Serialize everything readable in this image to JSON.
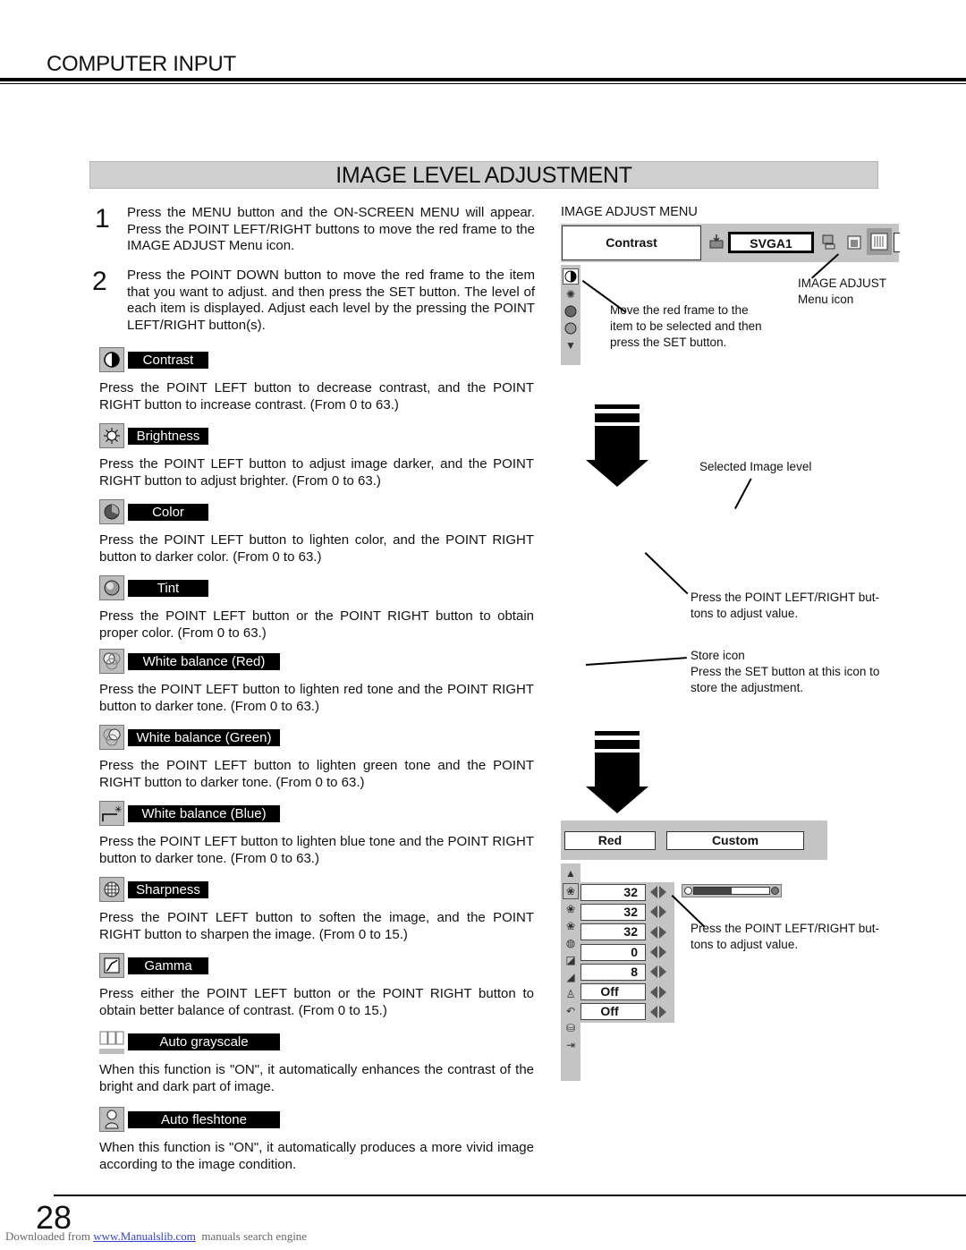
{
  "header": {
    "section_title": "COMPUTER INPUT",
    "banner_title": "IMAGE LEVEL ADJUSTMENT"
  },
  "steps": [
    {
      "num": "1",
      "text": "Press the MENU button and the ON-SCREEN MENU will appear.  Press the POINT LEFT/RIGHT buttons to move the red frame to the IMAGE ADJUST Menu icon."
    },
    {
      "num": "2",
      "text": "Press the POINT DOWN button to move the red frame to the item that you want to adjust. and then press the SET button.  The level of each item is displayed.  Adjust each level by the pressing the POINT LEFT/RIGHT button(s)."
    }
  ],
  "items": [
    {
      "icon": "contrast-icon",
      "label": "Contrast",
      "desc": "Press the POINT LEFT button to decrease contrast, and the POINT RIGHT button to increase contrast.  (From 0 to 63.)"
    },
    {
      "icon": "brightness-icon",
      "label": "Brightness",
      "desc": "Press the POINT LEFT button to adjust image darker, and the POINT RIGHT button to adjust brighter.  (From 0 to 63.)"
    },
    {
      "icon": "color-icon",
      "label": "Color",
      "desc": "Press the POINT LEFT button to lighten color, and the POINT RIGHT button to darker color.  (From 0 to 63.)"
    },
    {
      "icon": "tint-icon",
      "label": "Tint",
      "desc": "Press the POINT LEFT button or the POINT RIGHT button to obtain proper color.  (From 0 to 63.)"
    },
    {
      "icon": "white-balance-red-icon",
      "label": "White balance (Red)",
      "desc": "Press the POINT LEFT button to lighten red tone and the POINT RIGHT button to darker tone.  (From 0 to 63.)"
    },
    {
      "icon": "white-balance-green-icon",
      "label": "White balance (Green)",
      "desc": "Press the POINT LEFT button to lighten green tone and the POINT RIGHT button to darker tone.  (From 0 to 63.)"
    },
    {
      "icon": "white-balance-blue-icon",
      "label": "White balance (Blue)",
      "desc": "Press the POINT LEFT button to lighten blue tone and the POINT RIGHT button to darker tone.  (From 0 to 63.)"
    },
    {
      "icon": "sharpness-icon",
      "label": "Sharpness",
      "desc": "Press the POINT LEFT button to soften the image, and the POINT RIGHT button to sharpen the image.  (From 0 to 15.)"
    },
    {
      "icon": "gamma-icon",
      "label": "Gamma",
      "desc": "Press either the POINT LEFT button or the POINT RIGHT button to obtain better balance of contrast.  (From 0 to 15.)"
    },
    {
      "icon": "auto-grayscale-icon",
      "label": "Auto grayscale",
      "desc": "When this function is \"ON\", it automatically enhances the contrast of the bright and dark part of image."
    },
    {
      "icon": "auto-fleshtone-icon",
      "label": "Auto fleshtone",
      "desc": "When this function is \"ON\", it automatically produces a more vivid image according to the image condition."
    }
  ],
  "menu1": {
    "heading": "IMAGE ADJUST MENU",
    "selected_item": "Contrast",
    "source": "SVGA1",
    "callout_icon": "IMAGE ADJUST\nMenu icon",
    "callout_icon_l1": "IMAGE ADJUST",
    "callout_icon_l2": "Menu icon",
    "callout_frame": [
      "Move the red frame to the",
      "item to be selected and then",
      "press the SET button."
    ]
  },
  "callouts": {
    "selected_level": "Selected Image level",
    "adjust_1": [
      "Press the POINT LEFT/RIGHT but-",
      "tons to adjust value."
    ],
    "store": [
      "Store icon",
      "Press the SET button at this icon to",
      "store the adjustment."
    ],
    "adjust_2": [
      "Press the POINT LEFT/RIGHT but-",
      "tons to adjust value."
    ]
  },
  "menu2": {
    "selected_item": "Red",
    "mode": "Custom",
    "values": [
      "32",
      "32",
      "32",
      "0",
      "8",
      "Off",
      "Off"
    ],
    "slider_level_fraction": 0.5
  },
  "footer": {
    "page_number": "28",
    "download_prefix": "Downloaded from ",
    "download_link": "www.Manualslib.com",
    "download_suffix": "  manuals search engine"
  }
}
